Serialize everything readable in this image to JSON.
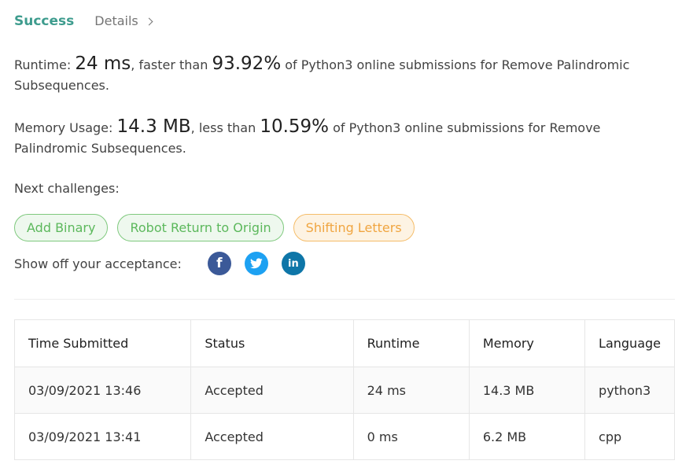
{
  "header": {
    "status": "Success",
    "details_label": "Details"
  },
  "runtime": {
    "label": "Runtime:",
    "value": "24 ms",
    "mid_text": ", faster than",
    "percent": "93.92%",
    "tail": "of Python3 online submissions for Remove Palindromic Subsequences."
  },
  "memory": {
    "label": "Memory Usage:",
    "value": "14.3 MB",
    "mid_text": ", less than",
    "percent": "10.59%",
    "tail": "of Python3 online submissions for Remove Palindromic Subsequences."
  },
  "next": {
    "label": "Next challenges:",
    "challenges": [
      {
        "label": "Add Binary",
        "difficulty": "easy"
      },
      {
        "label": "Robot Return to Origin",
        "difficulty": "easy"
      },
      {
        "label": "Shifting Letters",
        "difficulty": "medium"
      }
    ]
  },
  "share": {
    "label": "Show off your acceptance:",
    "icons": [
      "facebook-icon",
      "twitter-icon",
      "linkedin-icon"
    ],
    "facebook_glyph": "f",
    "linkedin_glyph": "in"
  },
  "table": {
    "headers": [
      "Time Submitted",
      "Status",
      "Runtime",
      "Memory",
      "Language"
    ],
    "rows": [
      {
        "time": "03/09/2021 13:46",
        "status": "Accepted",
        "runtime": "24 ms",
        "memory": "14.3 MB",
        "language": "python3"
      },
      {
        "time": "03/09/2021 13:41",
        "status": "Accepted",
        "runtime": "0 ms",
        "memory": "6.2 MB",
        "language": "cpp"
      }
    ]
  },
  "colors": {
    "success": "#3e9c8e",
    "easy": "#5cb85c",
    "medium": "#f0a540",
    "facebook": "#3b5998",
    "twitter": "#1da1f2",
    "linkedin": "#0e76a8"
  }
}
